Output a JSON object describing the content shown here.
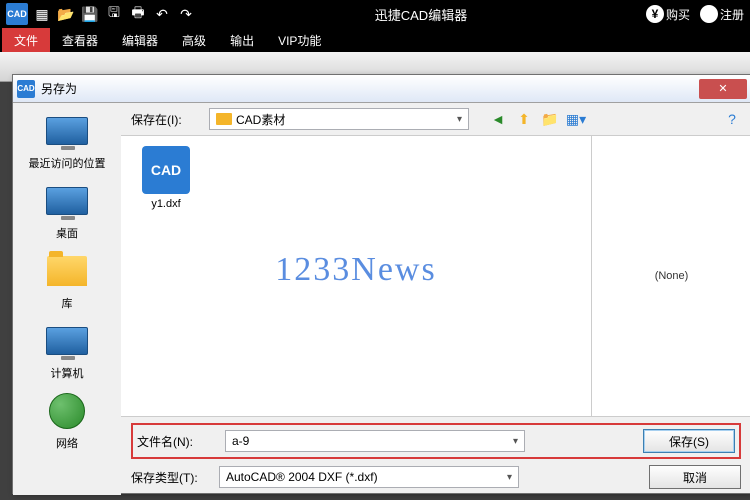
{
  "titlebar": {
    "appTitle": "迅捷CAD编辑器",
    "appLogo": "CAD",
    "buy": "购买",
    "register": "注册",
    "yen": "¥"
  },
  "menu": {
    "tabs": [
      "文件",
      "查看器",
      "编辑器",
      "高级",
      "输出",
      "VIP功能"
    ]
  },
  "dialog": {
    "title": "另存为",
    "close": "✕",
    "locationLabel": "保存在(I):",
    "locationValue": "CAD素材",
    "fileNameLabel": "文件名(N):",
    "fileNameValue": "a-9",
    "fileTypeLabel": "保存类型(T):",
    "fileTypeValue": "AutoCAD® 2004 DXF (*.dxf)",
    "saveBtn": "保存(S)",
    "cancelBtn": "取消",
    "previewNone": "(None)",
    "helpIcon": "?"
  },
  "places": [
    {
      "label": "最近访问的位置",
      "kind": "monitor"
    },
    {
      "label": "桌面",
      "kind": "monitor"
    },
    {
      "label": "库",
      "kind": "folder"
    },
    {
      "label": "计算机",
      "kind": "monitor"
    },
    {
      "label": "网络",
      "kind": "globe"
    }
  ],
  "file": {
    "label": "y1.dxf",
    "iconText": "CAD"
  },
  "watermark": "1233News"
}
